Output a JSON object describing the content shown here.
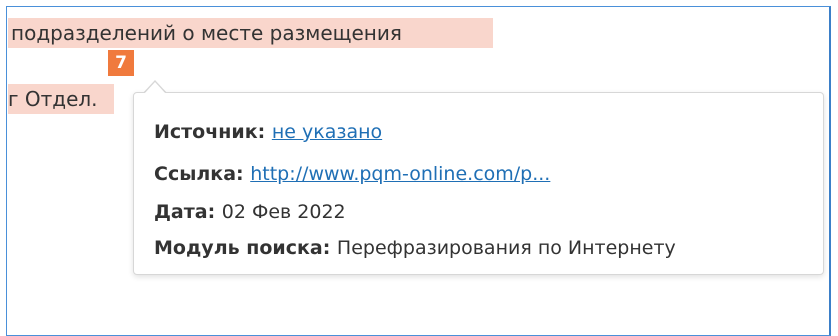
{
  "text": {
    "line1": "подразделений о месте размещения",
    "line2": "г Отдел."
  },
  "badge": {
    "number": "7",
    "color": "#f07a3d"
  },
  "popup": {
    "source_label": "Источник:",
    "source_value": "не указано",
    "link_label": "Ссылка:",
    "link_value": "http://www.pqm-online.com/p...",
    "date_label": "Дата:",
    "date_value": "02 Фев 2022",
    "module_label": "Модуль поиска:",
    "module_value": "Перефразирования по Интернету"
  },
  "colors": {
    "highlight": "#f9d6cc",
    "link": "#1f6fb5",
    "frame_border": "#4a90d9"
  }
}
